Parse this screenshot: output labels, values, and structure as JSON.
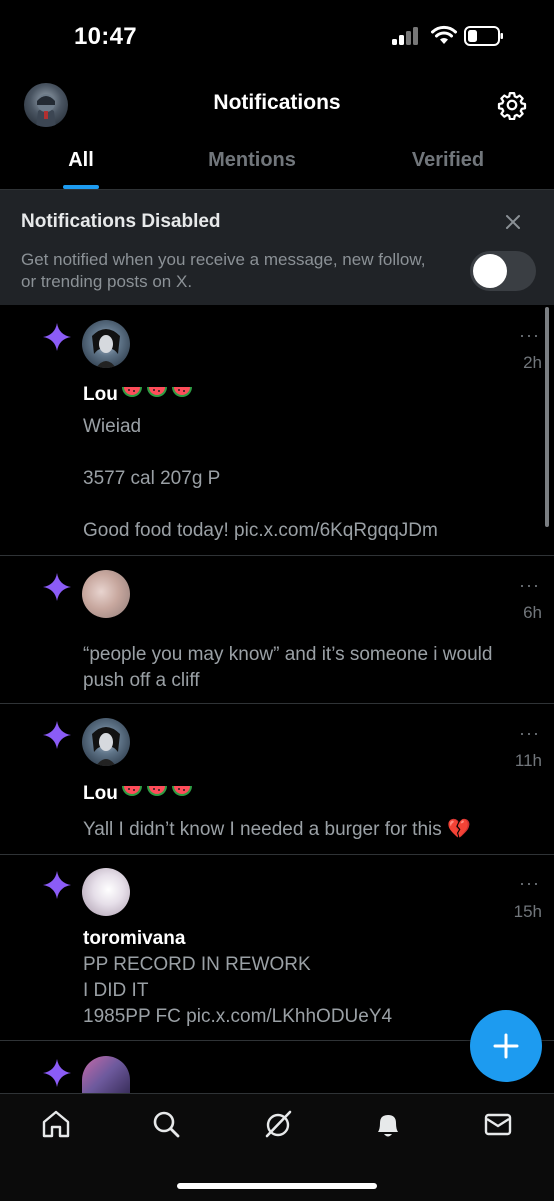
{
  "status_bar": {
    "time": "10:47"
  },
  "header": {
    "title": "Notifications"
  },
  "tabs": [
    {
      "label": "All",
      "active": true
    },
    {
      "label": "Mentions",
      "active": false
    },
    {
      "label": "Verified",
      "active": false
    }
  ],
  "banner": {
    "title": "Notifications Disabled",
    "text": "Get notified when you receive a message, new follow, or trending posts on X.",
    "toggle_on": false
  },
  "notifications": [
    {
      "time": "2h",
      "name": "Lou",
      "name_emoji": "watermelon x3",
      "lines": [
        "Wieiad",
        "",
        "3577 cal 207g P",
        "",
        "Good food today! pic.x.com/6KqRgqqJDm"
      ]
    },
    {
      "time": "6h",
      "name": "",
      "lines": [
        "“people you may know” and it’s someone i would push off a cliff"
      ]
    },
    {
      "time": "11h",
      "name": "Lou",
      "name_emoji": "watermelon x3",
      "lines": [
        "Yall I didn’t know I needed a burger for this 💔"
      ]
    },
    {
      "time": "15h",
      "name": "toromivana",
      "lines": [
        "PP RECORD IN REWORK",
        "I DID IT",
        "1985PP FC pic.x.com/LKhhODUeY4"
      ]
    }
  ],
  "more_label": "···",
  "colors": {
    "accent": "#1d9bf0",
    "sparkle": "#8b5cf6",
    "background": "#000000",
    "muted": "#71767b"
  },
  "bottom_nav": [
    "home-icon",
    "search-icon",
    "grok-icon",
    "bell-icon",
    "mail-icon"
  ]
}
